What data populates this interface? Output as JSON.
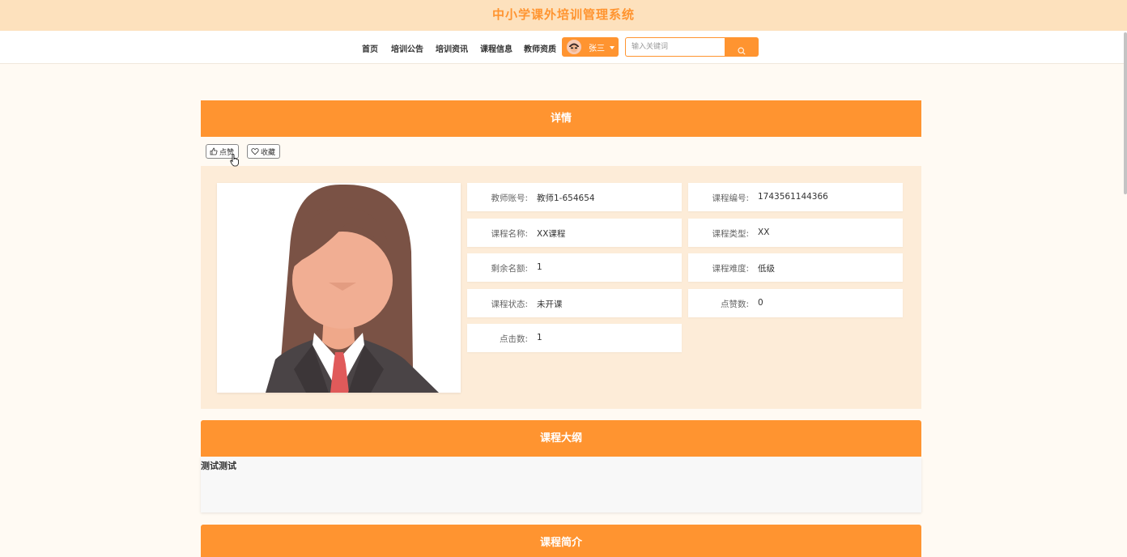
{
  "header": {
    "title": "中小学课外培训管理系统"
  },
  "nav": {
    "items": [
      "首页",
      "培训公告",
      "培训资讯",
      "课程信息",
      "教师资质"
    ],
    "user_name": "张三"
  },
  "search": {
    "placeholder": "输入关键词",
    "value": ""
  },
  "detail": {
    "title": "详情",
    "like_label": "点赞",
    "favorite_label": "收藏",
    "fields": [
      {
        "label": "教师账号:",
        "value": "教师1-654654"
      },
      {
        "label": "课程编号:",
        "value": "1743561144366"
      },
      {
        "label": "课程名称:",
        "value": "XX课程"
      },
      {
        "label": "课程类型:",
        "value": "XX"
      },
      {
        "label": "剩余名额:",
        "value": "1"
      },
      {
        "label": "课程难度:",
        "value": "低级"
      },
      {
        "label": "课程状态:",
        "value": "未开课"
      },
      {
        "label": "点赞数:",
        "value": "0"
      },
      {
        "label": "点击数:",
        "value": "1"
      }
    ]
  },
  "syllabus": {
    "title": "课程大纲",
    "content": "测试测试"
  },
  "intro": {
    "title": "课程简介"
  },
  "colors": {
    "accent": "#ff9430",
    "banner": "#fde1bd",
    "detail_bg": "#fdecd8",
    "page_bg": "#fffaf3"
  }
}
